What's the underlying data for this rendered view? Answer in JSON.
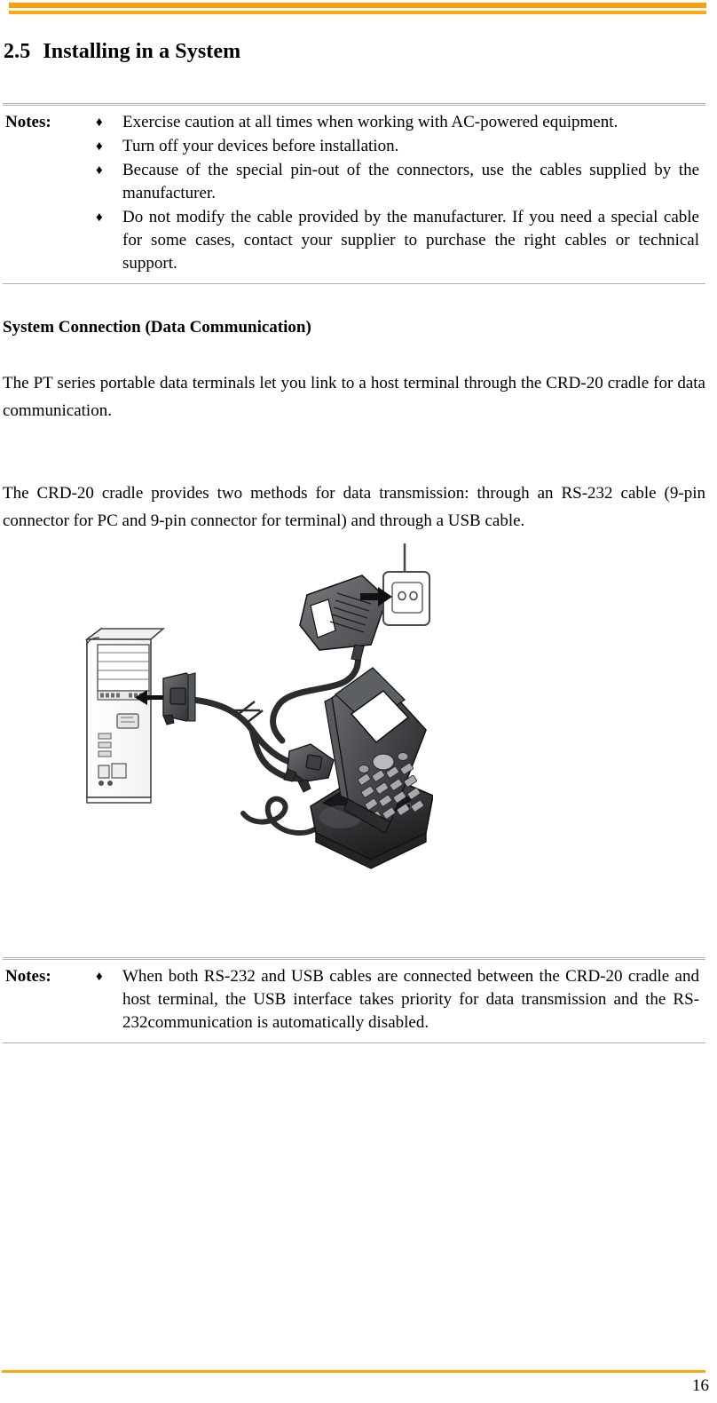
{
  "document": {
    "page_number": "16",
    "accent_color": "#FF9E0D",
    "footer_rule_color": "#FFA417"
  },
  "heading": {
    "number": "2.5",
    "title": "Installing in a System"
  },
  "notes_top": {
    "label": "Notes:",
    "bullet_glyph": "♦",
    "items": [
      "Exercise caution at all times when working with AC-powered equipment.",
      "Turn off your devices before installation.",
      "Because of the special pin-out of the connectors, use the cables supplied by the manufacturer.",
      "Do not modify the cable provided by the manufacturer. If you need a special cable for some cases, contact your supplier to purchase the right cables or technical support."
    ]
  },
  "body": {
    "subheading": "System Connection (Data Communication)",
    "paragraph_1": "The PT series portable data terminals let you link to a host terminal through the CRD-20 cradle for data communication.",
    "paragraph_2": "The CRD-20 cradle provides two methods for data transmission: through an RS-232 cable (9-pin connector for PC and 9-pin connector for terminal) and through a USB cable."
  },
  "figure": {
    "caption": "",
    "parts": {
      "pc_tower": "PC tower / host computer",
      "serial_connector": "RS-232 9-pin connector into PC",
      "cable_break": "cable break mark",
      "usb_connector": "connector into CRD-20 cradle",
      "cradle": "CRD-20 cradle",
      "terminal": "PT series portable data terminal",
      "power_adapter": "AC power adapter",
      "wall_outlet": "wall power outlet"
    }
  },
  "notes_bottom": {
    "label": "Notes:",
    "bullet_glyph": "♦",
    "items": [
      "When both RS-232 and USB cables are connected between the CRD-20 cradle and host terminal, the USB interface takes priority for data transmission and the RS-232communication is automatically disabled."
    ]
  }
}
